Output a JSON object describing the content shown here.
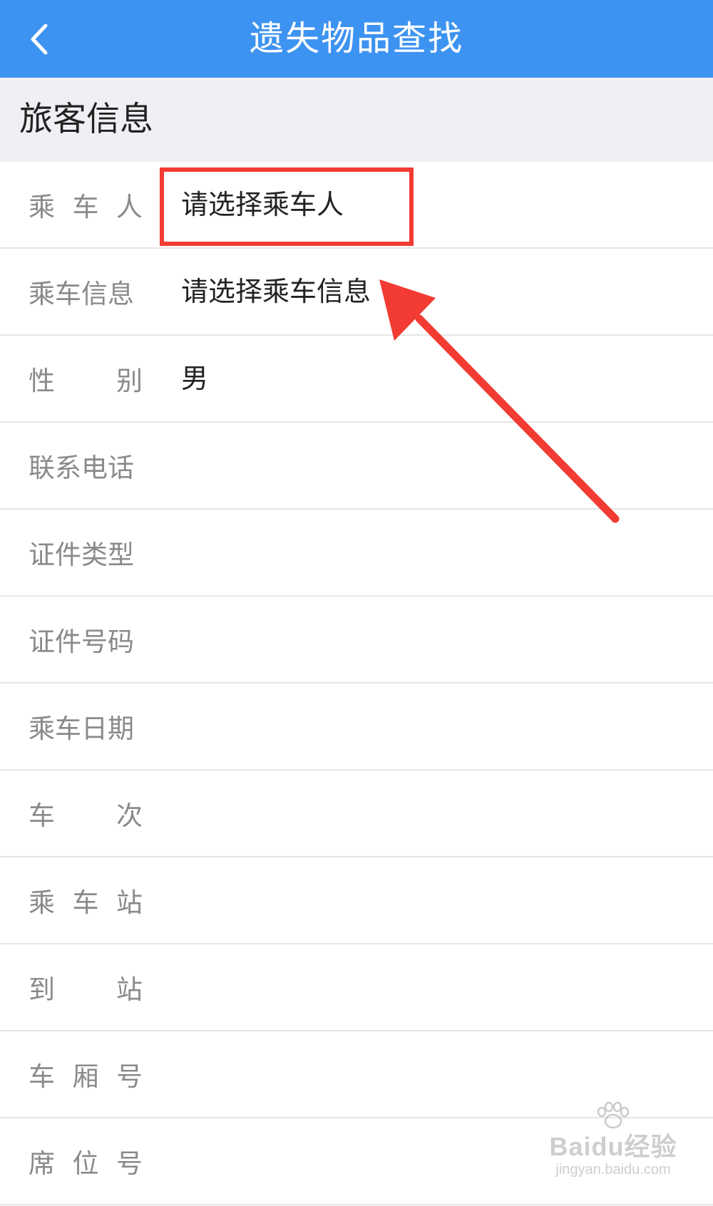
{
  "colors": {
    "header_bg": "#3d93f1",
    "highlight": "#f23b32"
  },
  "header": {
    "back_icon": "chevron-left-icon",
    "title": "遗失物品查找"
  },
  "section": {
    "title": "旅客信息"
  },
  "rows": [
    {
      "label_chars": [
        "乘",
        "车",
        "人"
      ],
      "value": "请选择乘车人"
    },
    {
      "label_chars": [
        "乘车信息"
      ],
      "value": "请选择乘车信息"
    },
    {
      "label_chars": [
        "性",
        "别"
      ],
      "value": "男"
    },
    {
      "label_chars": [
        "联系电话"
      ],
      "value": ""
    },
    {
      "label_chars": [
        "证件类型"
      ],
      "value": ""
    },
    {
      "label_chars": [
        "证件号码"
      ],
      "value": ""
    },
    {
      "label_chars": [
        "乘车日期"
      ],
      "value": ""
    },
    {
      "label_chars": [
        "车",
        "次"
      ],
      "value": ""
    },
    {
      "label_chars": [
        "乘",
        "车",
        "站"
      ],
      "value": ""
    },
    {
      "label_chars": [
        "到",
        "站"
      ],
      "value": ""
    },
    {
      "label_chars": [
        "车",
        "厢",
        "号"
      ],
      "value": ""
    },
    {
      "label_chars": [
        "席",
        "位",
        "号"
      ],
      "value": ""
    }
  ],
  "watermark": {
    "brand": "Baidu经验",
    "domain": "jingyan.baidu.com"
  }
}
